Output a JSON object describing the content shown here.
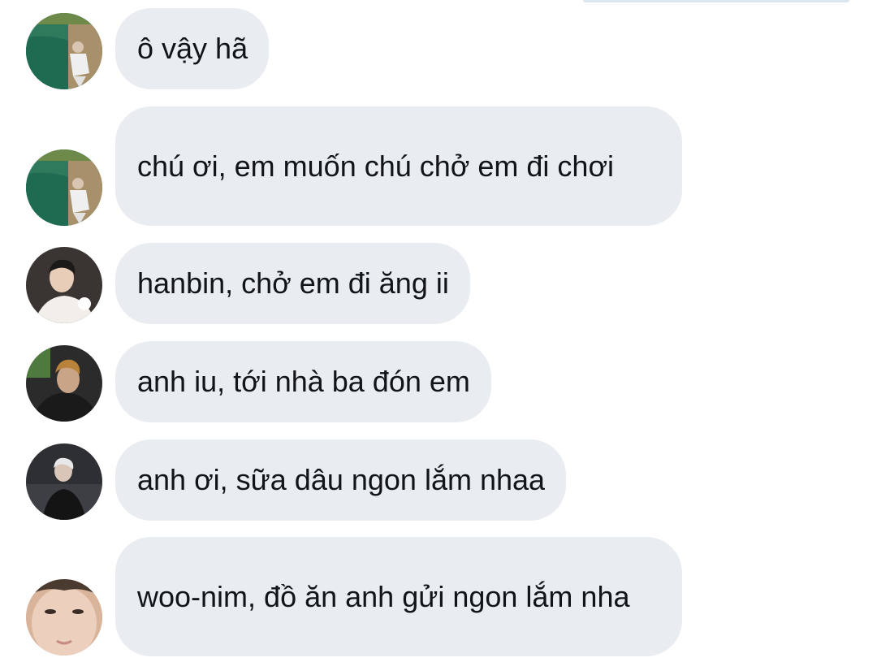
{
  "conversation": {
    "messages": [
      {
        "avatar": "avatar-green-water",
        "text": "ô vậy hã"
      },
      {
        "avatar": "avatar-green-water",
        "text": "chú ơi, em muốn chú chở em đi chơi"
      },
      {
        "avatar": "avatar-white-shirt",
        "text": "hanbin, chở em đi ăng ii"
      },
      {
        "avatar": "avatar-car-selfie",
        "text": "anh iu, tới nhà ba đón em"
      },
      {
        "avatar": "avatar-night-portrait",
        "text": "anh ơi, sữa dâu ngon lắm nhaa"
      },
      {
        "avatar": "avatar-closeup-face",
        "text": "woo-nim, đồ ăn anh gửi ngon lắm nha"
      }
    ]
  },
  "colors": {
    "bubble_bg": "#e9ecf0",
    "text": "#111418",
    "background": "#ffffff"
  }
}
